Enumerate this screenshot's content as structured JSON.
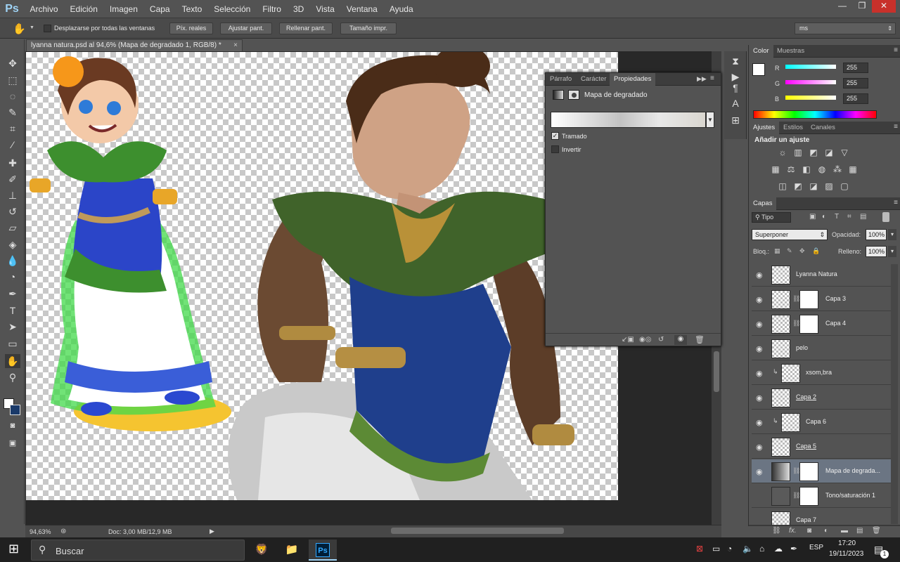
{
  "app": {
    "logo": "Ps",
    "menus": [
      "Archivo",
      "Edición",
      "Imagen",
      "Capa",
      "Texto",
      "Selección",
      "Filtro",
      "3D",
      "Vista",
      "Ventana",
      "Ayuda"
    ],
    "window_controls": [
      "minimize-icon",
      "restore-icon",
      "close-icon"
    ]
  },
  "options": {
    "checkbox_label": "Desplazarse por todas las ventanas",
    "buttons": [
      "Píx. reales",
      "Ajustar pant.",
      "Rellenar pant.",
      "Tamaño impr."
    ],
    "workspace": "ms"
  },
  "document": {
    "tab_title": "lyanna natura.psd al 94,6% (Mapa de degradado 1, RGB/8) *",
    "zoom": "94,63%",
    "doc_info": "Doc: 3,00 MB/12,9 MB"
  },
  "properties": {
    "tabs": [
      "Párrafo",
      "Carácter",
      "Propiedades"
    ],
    "active_tab": "Propiedades",
    "title": "Mapa de degradado",
    "dither_label": "Tramado",
    "dither_checked": true,
    "invert_label": "Invertir",
    "invert_checked": false
  },
  "color_panel": {
    "tabs": [
      "Color",
      "Muestras"
    ],
    "channels": [
      {
        "name": "R",
        "value": "255"
      },
      {
        "name": "G",
        "value": "255"
      },
      {
        "name": "B",
        "value": "255"
      }
    ]
  },
  "adjustments": {
    "tabs": [
      "Ajustes",
      "Estilos",
      "Canales"
    ],
    "title": "Añadir un ajuste"
  },
  "layers": {
    "tab": "Capas",
    "filter": "Tipo",
    "blend_mode": "Superponer",
    "opacity_label": "Opacidad:",
    "opacity": "100%",
    "lock_label": "Bloq.:",
    "fill_label": "Relleno:",
    "fill": "100%",
    "items": [
      {
        "name": "Lyanna Natura"
      },
      {
        "name": "Capa 3"
      },
      {
        "name": "Capa 4"
      },
      {
        "name": "pelo"
      },
      {
        "name": "xsom,bra"
      },
      {
        "name": "Capa 2"
      },
      {
        "name": "Capa 6"
      },
      {
        "name": "Capa 5"
      },
      {
        "name": "Mapa de degrada..."
      },
      {
        "name": "Tono/saturación 1"
      },
      {
        "name": "Capa 7"
      }
    ],
    "footer_fx": "fx."
  },
  "taskbar": {
    "search_placeholder": "Buscar",
    "lang": "ESP",
    "time": "17:20",
    "date": "19/11/2023",
    "notifications": "1"
  },
  "colors": {
    "ps_blue": "#9fd3f5",
    "selected_layer": "#6b7583",
    "close_red": "#c8312b",
    "foreground": "#ffffff",
    "background": "#1a3a6a"
  }
}
